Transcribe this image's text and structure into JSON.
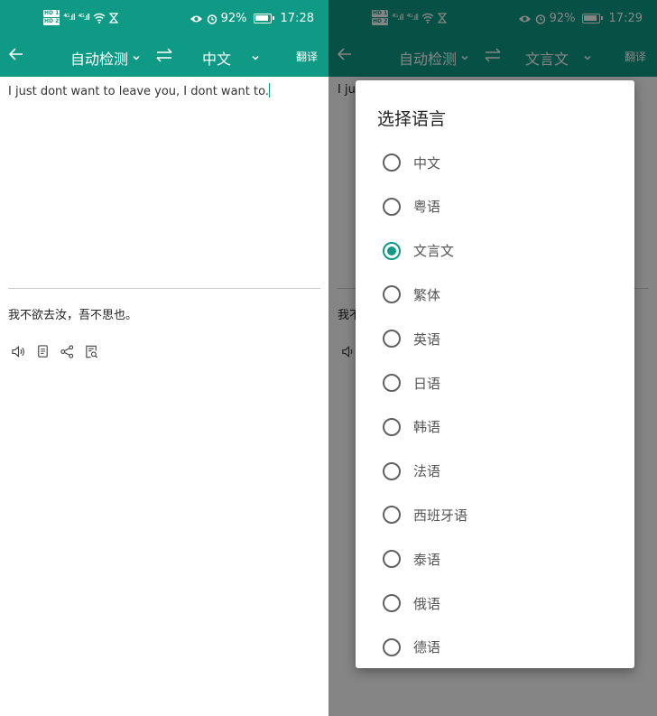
{
  "left": {
    "status": {
      "battery": "92%",
      "time": "17:28"
    },
    "toolbar": {
      "source_lang": "自动检测",
      "target_lang": "中文",
      "translate": "翻译"
    },
    "input_text": "I just dont want to leave you, I dont want to.",
    "output_text": "我不欲去汝，吾不思也。"
  },
  "right": {
    "status": {
      "battery": "92%",
      "time": "17:29"
    },
    "toolbar": {
      "source_lang": "自动检测",
      "target_lang": "文言文",
      "translate": "翻译"
    },
    "input_text_partial": "I ju",
    "output_text_partial": "我不",
    "dialog": {
      "title": "选择语言",
      "options": [
        "中文",
        "粤语",
        "文言文",
        "繁体",
        "英语",
        "日语",
        "韩语",
        "法语",
        "西班牙语",
        "泰语",
        "俄语",
        "德语"
      ],
      "selected": "文言文"
    }
  },
  "colors": {
    "accent": "#0f9a86",
    "text": "#222222"
  }
}
